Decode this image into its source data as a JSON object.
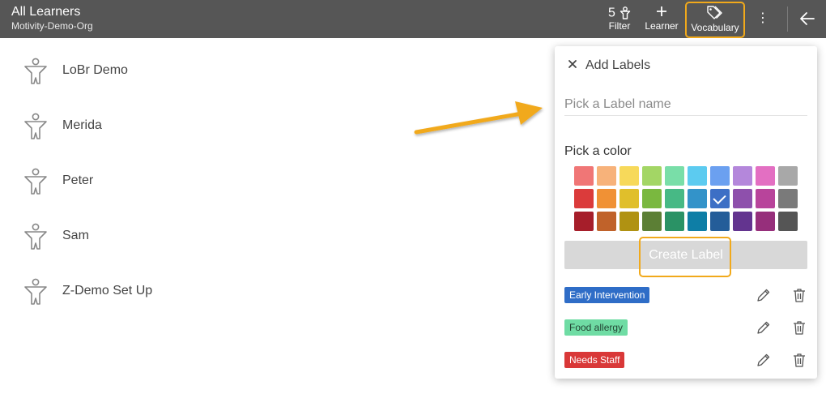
{
  "header": {
    "title": "All Learners",
    "subtitle": "Motivity-Demo-Org",
    "filter": {
      "count": "5",
      "label": "Filter",
      "icon": "person-filter-icon"
    },
    "learner_button": {
      "label": "Learner",
      "icon": "plus-icon"
    },
    "vocabulary_button": {
      "label": "Vocabulary",
      "icon": "tags-icon"
    },
    "more_icon": "kebab-menu-icon",
    "back_icon": "arrow-left-icon",
    "highlight_color": "#f1a91b"
  },
  "learners": [
    {
      "name": "LoBr Demo",
      "icon": "person-icon"
    },
    {
      "name": "Merida",
      "icon": "person-icon"
    },
    {
      "name": "Peter",
      "icon": "person-icon"
    },
    {
      "name": "Sam",
      "icon": "person-icon"
    },
    {
      "name": "Z-Demo Set Up",
      "icon": "person-icon"
    }
  ],
  "popup": {
    "title": "Add Labels",
    "close_icon": "close-icon",
    "input_placeholder": "Pick a Label name",
    "input_value": "",
    "pick_color_label": "Pick a color",
    "palette": [
      [
        "#f07676",
        "#f7b27a",
        "#f7d95a",
        "#a3d665",
        "#79dea8",
        "#5ccbf0",
        "#6ba0f0",
        "#b487db",
        "#e36fc2",
        "#a8a8a8"
      ],
      [
        "#db3b3b",
        "#f09135",
        "#e0bf2b",
        "#7ab83f",
        "#47b985",
        "#3393c9",
        "#3d6fc5",
        "#8e50ac",
        "#b8449b",
        "#7a7a7a"
      ],
      [
        "#a61e2a",
        "#c0622a",
        "#b09212",
        "#5c7f35",
        "#2a9265",
        "#0e7ea6",
        "#245d99",
        "#63348f",
        "#962f7b",
        "#555555"
      ]
    ],
    "selected_color": "#3d6fc5",
    "create_button_label": "Create Label",
    "labels": [
      {
        "text": "Early Intervention",
        "bg": "#2f6dc7",
        "fg": "#ffffff"
      },
      {
        "text": "Food allergy",
        "bg": "#6fdca4",
        "fg": "#224433"
      },
      {
        "text": "Needs Staff",
        "bg": "#d93838",
        "fg": "#ffffff"
      }
    ],
    "edit_icon": "pencil-icon",
    "delete_icon": "trash-icon"
  },
  "annotation": {
    "arrow_color": "#f1a91b",
    "icon": "annotation-arrow-icon"
  }
}
